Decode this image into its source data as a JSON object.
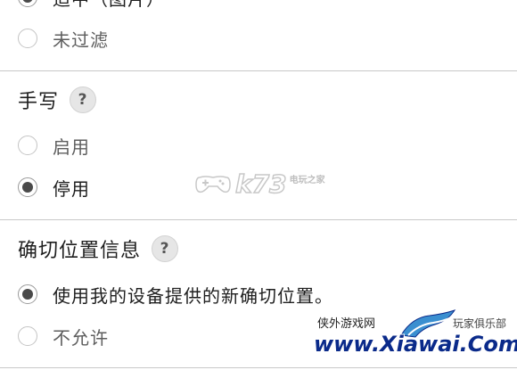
{
  "filter_section": {
    "partial_option_label": "适中（图片）",
    "unfiltered_option_label": "未过滤"
  },
  "handwriting_section": {
    "title": "手写",
    "help_glyph": "?",
    "options": [
      {
        "label": "启用",
        "selected": false
      },
      {
        "label": "停用",
        "selected": true
      }
    ]
  },
  "precise_location_section": {
    "title": "确切位置信息",
    "help_glyph": "?",
    "options": [
      {
        "label": "使用我的设备提供的新确切位置。",
        "selected": true
      },
      {
        "label": "不允许",
        "selected": false
      }
    ]
  },
  "watermarks": {
    "k73_text": "k73",
    "k73_subtext": "电玩之家",
    "xiawai_left_text": "侠外游戏网",
    "xiawai_right_text": "玩家俱乐部",
    "xiawai_domain": "www.Xiawai.Com"
  },
  "icons": {
    "help": "question-circle-icon",
    "radio_selected": "radio-selected-icon",
    "radio_unselected": "radio-unselected-icon"
  },
  "colors": {
    "divider": "#c8c8c8",
    "radio_dot": "#4a4a4a",
    "radio_border": "#c4c4c4",
    "help_icon_bg": "#e6e6e6",
    "watermark_domain": "#0a2a8a"
  }
}
